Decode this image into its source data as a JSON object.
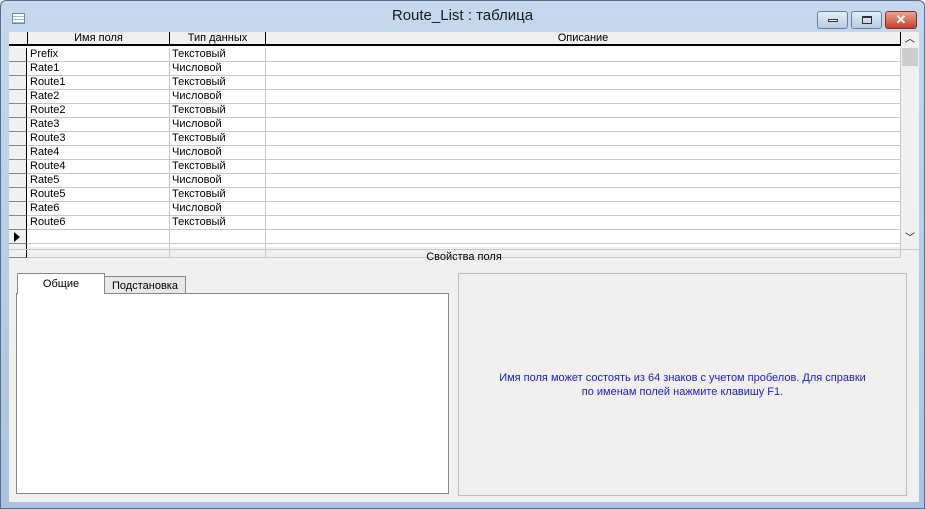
{
  "window": {
    "title": "Route_List : таблица"
  },
  "grid": {
    "headers": [
      "Имя поля",
      "Тип данных",
      "Описание"
    ],
    "rows": [
      [
        "Prefix",
        "Текстовый"
      ],
      [
        "Rate1",
        "Числовой"
      ],
      [
        "Route1",
        "Текстовый"
      ],
      [
        "Rate2",
        "Числовой"
      ],
      [
        "Route2",
        "Текстовый"
      ],
      [
        "Rate3",
        "Числовой"
      ],
      [
        "Route3",
        "Текстовый"
      ],
      [
        "Rate4",
        "Числовой"
      ],
      [
        "Route4",
        "Текстовый"
      ],
      [
        "Rate5",
        "Числовой"
      ],
      [
        "Route5",
        "Текстовый"
      ],
      [
        "Rate6",
        "Числовой"
      ],
      [
        "Route6",
        "Текстовый"
      ]
    ]
  },
  "props": {
    "title": "Свойства поля",
    "tabs": [
      "Общие",
      "Подстановка"
    ],
    "hint": "Имя поля может состоять из 64 знаков с учетом пробелов.  Для справки по именам полей нажмите клавишу F1."
  }
}
